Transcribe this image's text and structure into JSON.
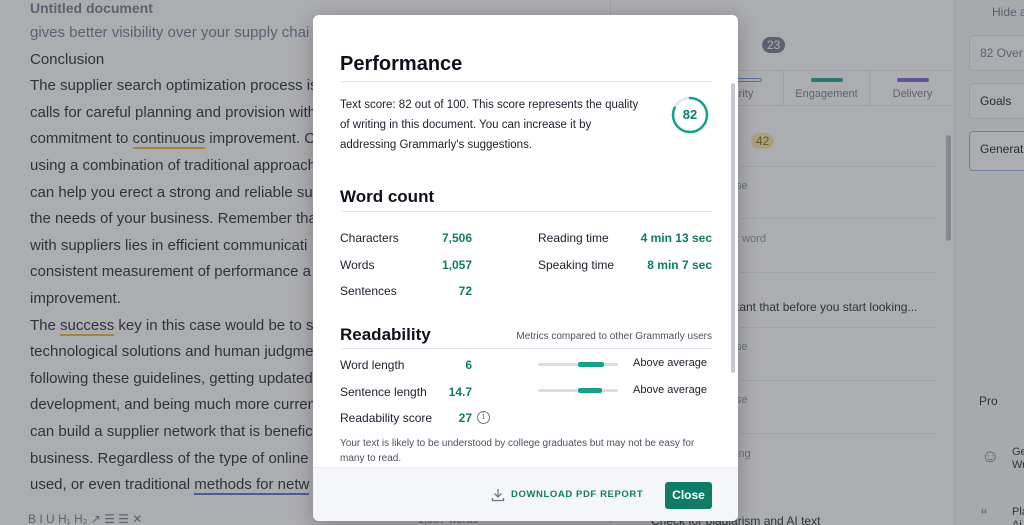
{
  "editor": {
    "title": "Untitled document",
    "lines": [
      "gives better visibility over your supply chai",
      "Conclusion",
      "The supplier search optimization process is",
      "calls for careful planning and provision with",
      [
        "commitment to ",
        "continuous",
        " improvement. C"
      ],
      "using a combination of traditional approach",
      "can help you erect a strong and reliable su",
      "the needs of your business. Remember tha",
      "with suppliers lies in efficient communicati",
      "consistent measurement of performance a",
      "improvement.",
      [
        "The ",
        "success",
        " key in this case would be to s"
      ],
      "technological solutions and human judgme",
      "following these guidelines, getting updated",
      "development, and being much more curren",
      "can build a supplier network that is benefic",
      "business. Regardless of the type of online",
      [
        "used, or even traditional ",
        "methods for netw",
        ""
      ]
    ],
    "footer_toolbar": "B  I  U   H₁  H₂   ↗   ☰  ☰   ✕",
    "word_count": "1,057 words"
  },
  "sidebar": {
    "suggestions_count": "23",
    "tabs": [
      {
        "label": "rity",
        "color": "#6d8fe0"
      },
      {
        "label": "Engagement",
        "color": "#15a18a"
      },
      {
        "label": "Delivery",
        "color": "#7b5ce0"
      }
    ],
    "clarity_count": "42",
    "items": [
      "se",
      "t word",
      "se",
      "se",
      "ing"
    ],
    "snippet": "tant that before you start looking...",
    "plagiarism": "Check for plagiarism and AI text"
  },
  "rightpane": {
    "hide": "Hide a",
    "overall": "82 Over",
    "goals": "Goals",
    "generate": "Generat",
    "pro": "Pro",
    "item1": "Ge Wr",
    "item2": "Pla Ai"
  },
  "modal": {
    "title": "Performance",
    "score_text": "Text score: 82 out of 100. This score represents the quality of writing in this document. You can increase it by addressing Grammarly's suggestions.",
    "score": "82",
    "score_value": 82,
    "word_count_title": "Word count",
    "stats": {
      "characters_label": "Characters",
      "characters": "7,506",
      "words_label": "Words",
      "words": "1,057",
      "sentences_label": "Sentences",
      "sentences": "72",
      "reading_time_label": "Reading time",
      "reading_time": "4 min 13 sec",
      "speaking_time_label": "Speaking time",
      "speaking_time": "8 min 7 sec"
    },
    "readability_title": "Readability",
    "metrics_note": "Metrics compared to other Grammarly users",
    "readability": {
      "word_length_label": "Word length",
      "word_length": "6",
      "sentence_length_label": "Sentence length",
      "sentence_length": "14.7",
      "score_label": "Readability score",
      "score": "27",
      "word_length_rating": "Above average",
      "sentence_length_rating": "Above average",
      "word_length_level": 0.75,
      "sentence_length_level": 0.72
    },
    "readability_note": "Your text is likely to be understood by college graduates but may not be easy for many to read.",
    "download_label": "DOWNLOAD PDF REPORT",
    "close_label": "Close",
    "colors": {
      "accent": "#0e7c66",
      "gauge": "#15a18a"
    }
  }
}
